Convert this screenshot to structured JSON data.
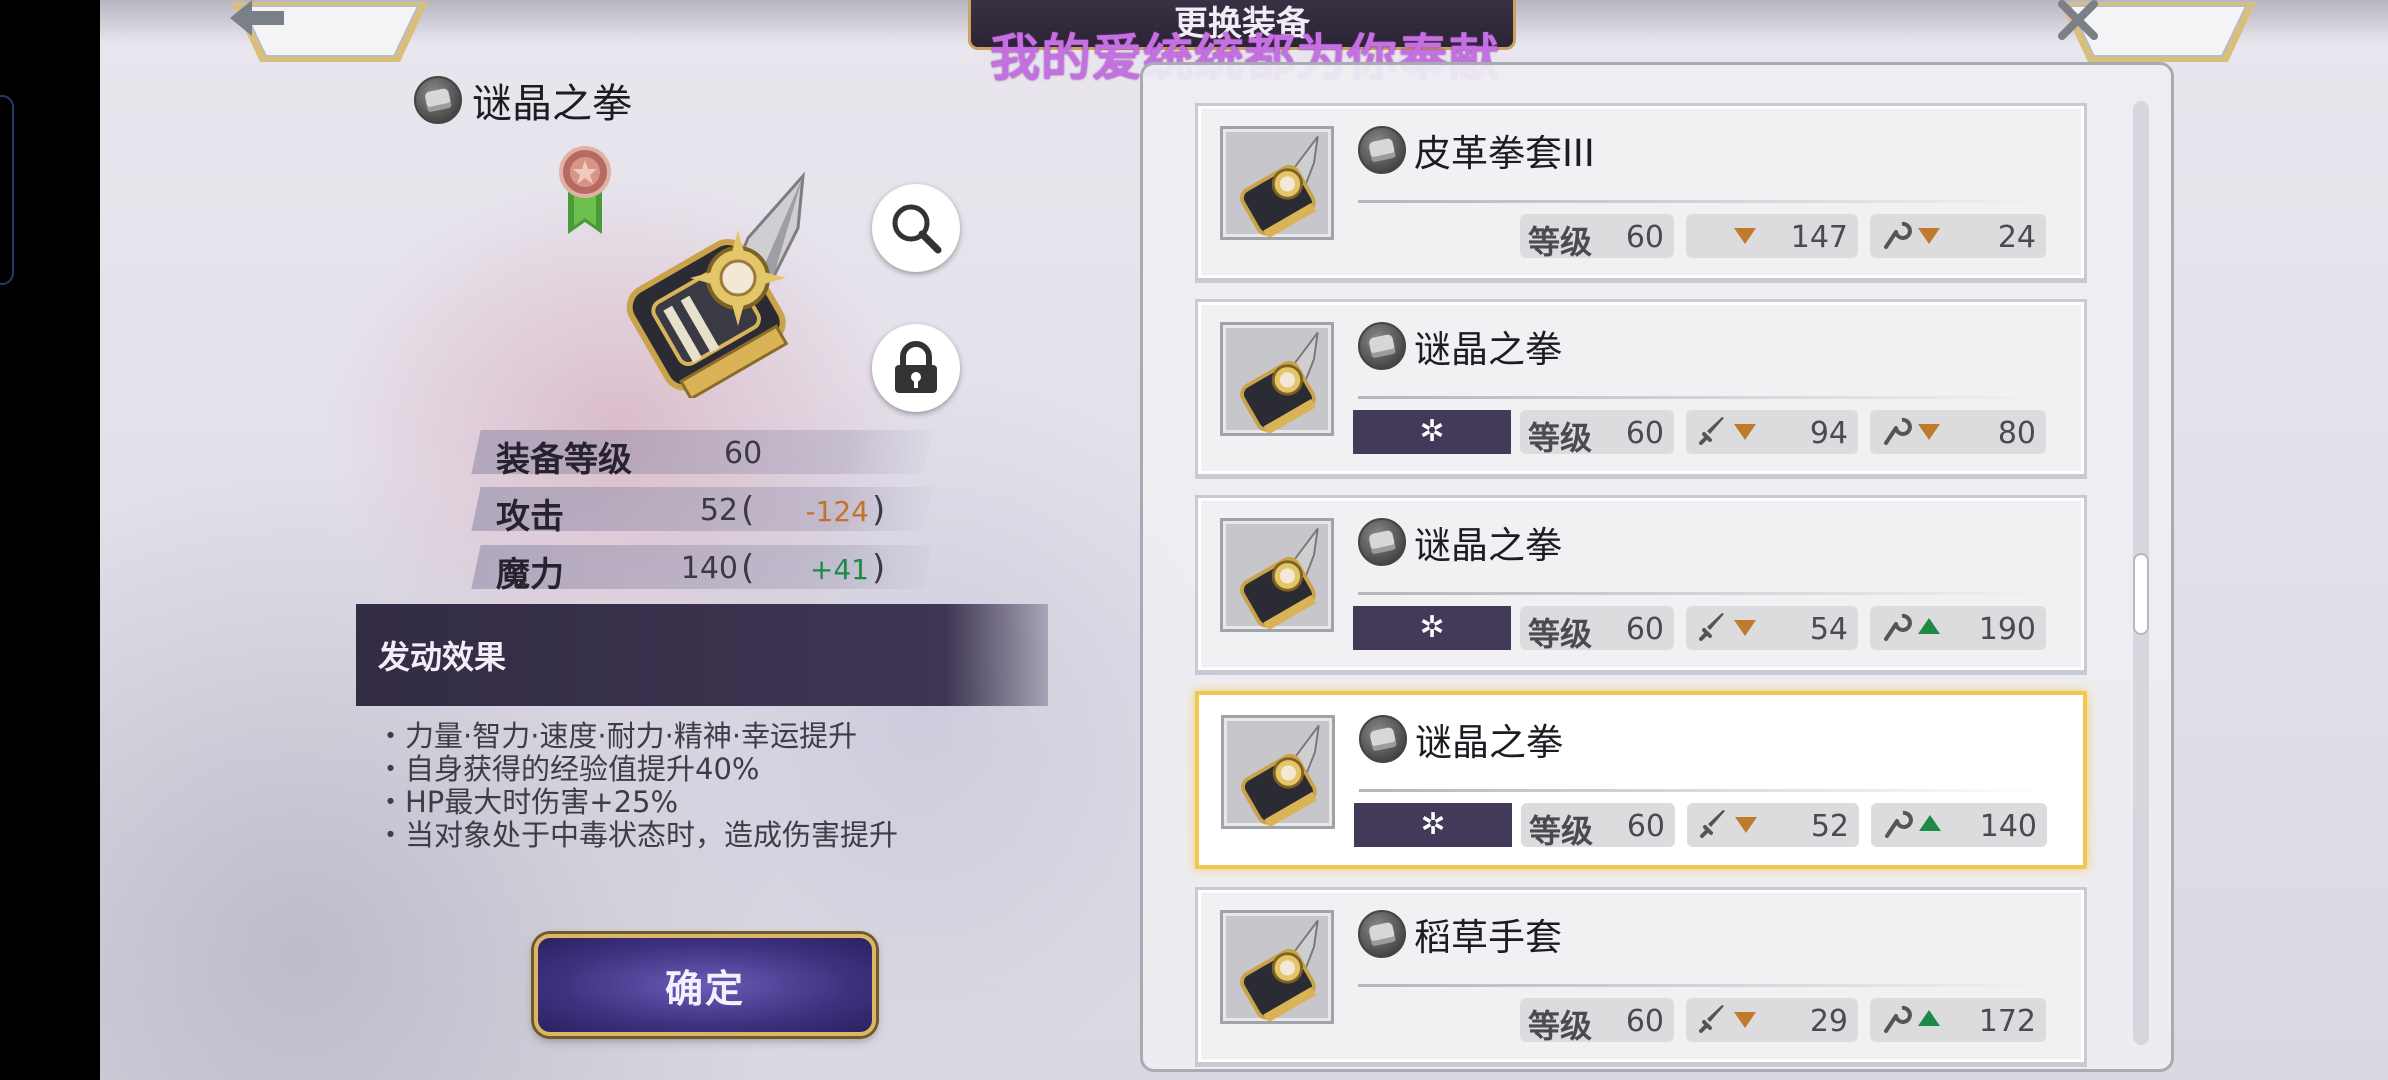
{
  "header": {
    "title": "更换装备",
    "watermark": "我的爱统统都为你奉献",
    "back_icon": "left-arrow-icon",
    "close_icon": "close-icon"
  },
  "selected_item": {
    "name": "谜晶之拳",
    "stats": [
      {
        "label": "装备等级",
        "value": "60"
      },
      {
        "label": "攻击",
        "value": "52",
        "diff": "-124",
        "diff_type": "negative"
      },
      {
        "label": "魔力",
        "value": "140",
        "diff": "+41",
        "diff_type": "positive"
      }
    ],
    "effect_title": "发动效果",
    "effects": [
      "・力量·智力·速度·耐力·精神·幸运提升",
      "・自身获得的经验值提升40%",
      "・HP最大时伤害+25%",
      "・当对象处于中毒状态时，造成伤害提升"
    ],
    "confirm_label": "确定"
  },
  "equipment_list": [
    {
      "name": "皮革拳套III",
      "level_label": "等级",
      "level": "60",
      "has_rune": false,
      "stat1": "147",
      "stat1_trend": "down",
      "stat2": "24",
      "stat2_trend": "down",
      "selected": false
    },
    {
      "name": "谜晶之拳",
      "level_label": "等级",
      "level": "60",
      "has_rune": true,
      "stat1": "94",
      "stat1_trend": "down",
      "stat2": "80",
      "stat2_trend": "down",
      "selected": false
    },
    {
      "name": "谜晶之拳",
      "level_label": "等级",
      "level": "60",
      "has_rune": true,
      "stat1": "54",
      "stat1_trend": "down",
      "stat2": "190",
      "stat2_trend": "up",
      "selected": false
    },
    {
      "name": "谜晶之拳",
      "level_label": "等级",
      "level": "60",
      "has_rune": true,
      "stat1": "52",
      "stat1_trend": "down",
      "stat2": "140",
      "stat2_trend": "up",
      "selected": true
    },
    {
      "name": "稻草手套",
      "level_label": "等级",
      "level": "60",
      "has_rune": false,
      "stat1": "29",
      "stat1_trend": "down",
      "stat2": "172",
      "stat2_trend": "up",
      "selected": false
    }
  ],
  "rune_symbol": "✲",
  "colors": {
    "panel_accent": "#433a5a",
    "selected_border": "#f0c850",
    "negative": "#c2722a",
    "positive": "#1e8a46"
  }
}
